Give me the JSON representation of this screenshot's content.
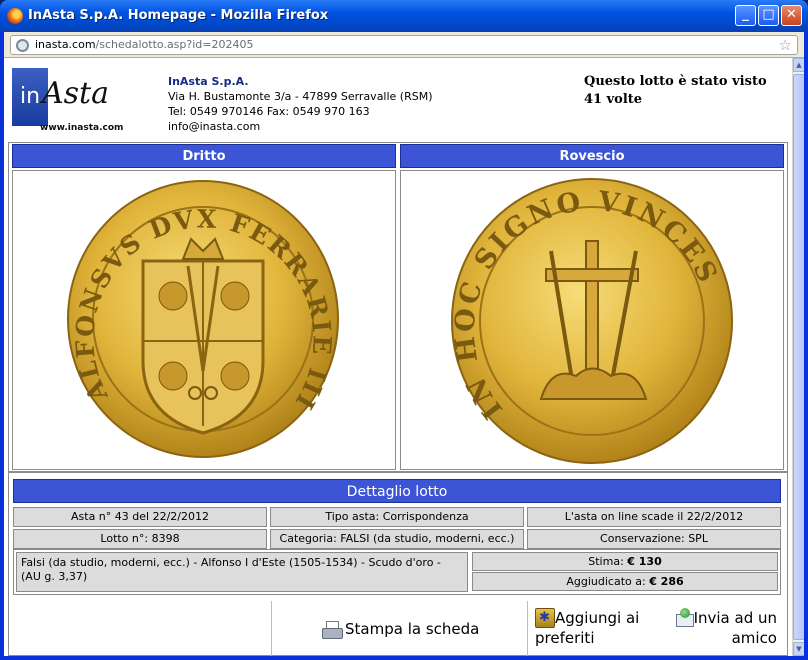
{
  "window": {
    "title": "InAsta S.p.A. Homepage - Mozilla Firefox",
    "minimize_label": "_",
    "maximize_label": "□",
    "close_label": "✕"
  },
  "address": {
    "domain": "inasta.com",
    "path": "/schedalotto.asp?id=202405",
    "bookmark_glyph": "☆"
  },
  "header": {
    "logo": {
      "in_text": "in",
      "asta_text": "Asta",
      "url_text": "www.inasta.com"
    },
    "company_name": "InAsta S.p.A.",
    "address_line": "Via H. Bustamonte 3/a - 47899 Serravalle (RSM)",
    "phone_line": "Tel: 0549 970146 Fax: 0549 970 163",
    "email": "info@inasta.com",
    "views_text": "Questo lotto è stato visto 41 volte"
  },
  "coin": {
    "obverse_label": "Dritto",
    "reverse_label": "Rovescio",
    "obverse_legend": "ALFONSVS DVX FERRARIE III",
    "reverse_legend": "IN HOC SIGNO VINCES"
  },
  "details": {
    "title": "Dettaglio lotto",
    "auction": "Asta n° 43 del 22/2/2012",
    "auction_type": "Tipo asta: Corrispondenza",
    "expiry": "L'asta on line scade il 22/2/2012",
    "lot": "Lotto n°: 8398",
    "category": "Categoria: FALSI (da studio, moderni, ecc.)",
    "condition": "Conservazione: SPL",
    "description": "Falsi (da studio, moderni, ecc.) - Alfonso I d'Este (1505-1534) - Scudo d'oro - (AU g. 3,37)",
    "estimate_label": "Stima:",
    "estimate_value": "€ 130",
    "awarded_label": "Aggiudicato a:",
    "awarded_value": "€ 286"
  },
  "actions": {
    "print": "Stampa la scheda",
    "favorites_line1": "Aggiungi ai",
    "favorites_line2": "preferiti",
    "send_line1": "Invia ad un",
    "send_line2": "amico"
  },
  "colors": {
    "header_blue": "#3b55d6",
    "coin_gold": "#e0b43a",
    "titlebar_blue": "#0053e1"
  }
}
